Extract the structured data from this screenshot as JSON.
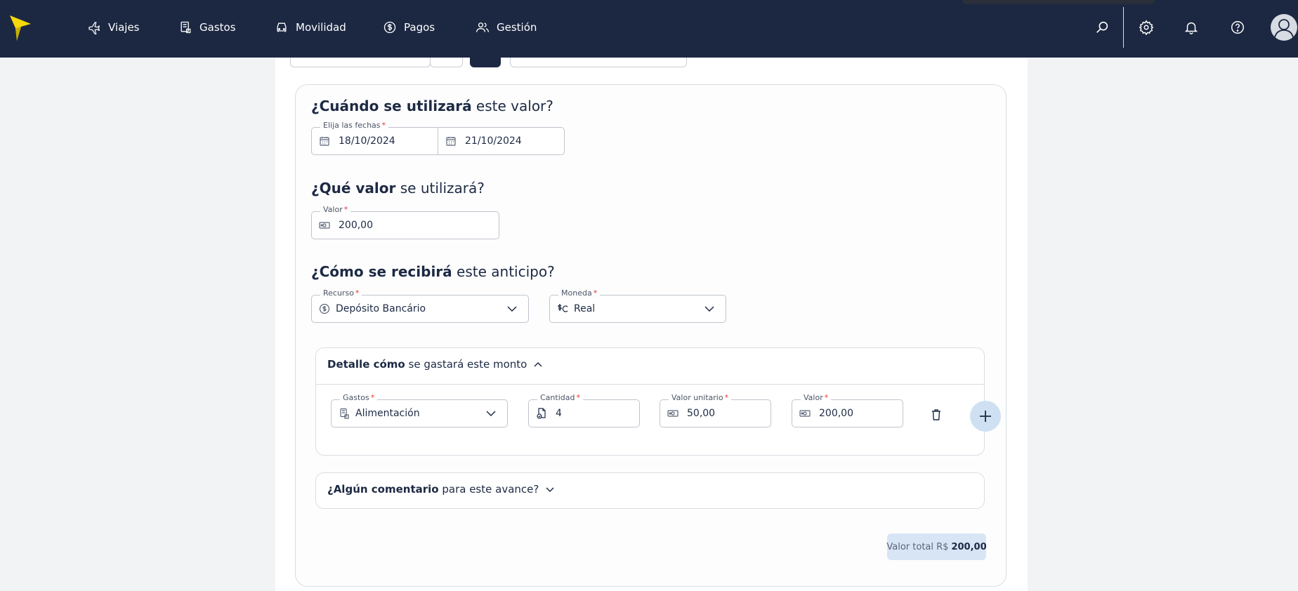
{
  "nav": {
    "items": [
      {
        "label": "Viajes",
        "icon": "plane-icon"
      },
      {
        "label": "Gastos",
        "icon": "receipt-icon"
      },
      {
        "label": "Movilidad",
        "icon": "car-icon"
      },
      {
        "label": "Pagos",
        "icon": "dollar-circle-icon"
      },
      {
        "label": "Gestión",
        "icon": "users-icon"
      }
    ],
    "right_icons": [
      "search-icon",
      "gear-icon",
      "bell-icon",
      "help-icon",
      "avatar"
    ]
  },
  "when": {
    "title_bold": "¿Cuándo se utilizará",
    "title_rest": " este valor?",
    "dates_label": "Elija las fechas",
    "start_date": "18/10/2024",
    "end_date": "21/10/2024"
  },
  "what": {
    "title_bold": "¿Qué valor",
    "title_rest": " se utilizará?",
    "value_label": "Valor",
    "value": "200,00"
  },
  "how": {
    "title_bold": "¿Cómo se recibirá",
    "title_rest": " este anticipo?",
    "resource_label": "Recurso",
    "resource_value": "Depósito Bancário",
    "currency_label": "Moneda",
    "currency_value": "Real"
  },
  "detail": {
    "title_bold": "Detalle cómo",
    "title_rest": " se gastará este monto",
    "expense_label": "Gastos",
    "expense_value": "Alimentación",
    "qty_label": "Cantidad",
    "qty_value": "4",
    "unit_label": "Valor unitario",
    "unit_value": "50,00",
    "amount_label": "Valor",
    "amount_value": "200,00"
  },
  "comment": {
    "title_bold": "¿Algún comentario",
    "title_rest": " para este avance?"
  },
  "total": {
    "label": "Valor total R$",
    "value": "200,00"
  },
  "colors": {
    "topbar": "#1c2842",
    "logo": "#f5d90a",
    "required": "#e53935",
    "badge": "#d8e5f5"
  }
}
